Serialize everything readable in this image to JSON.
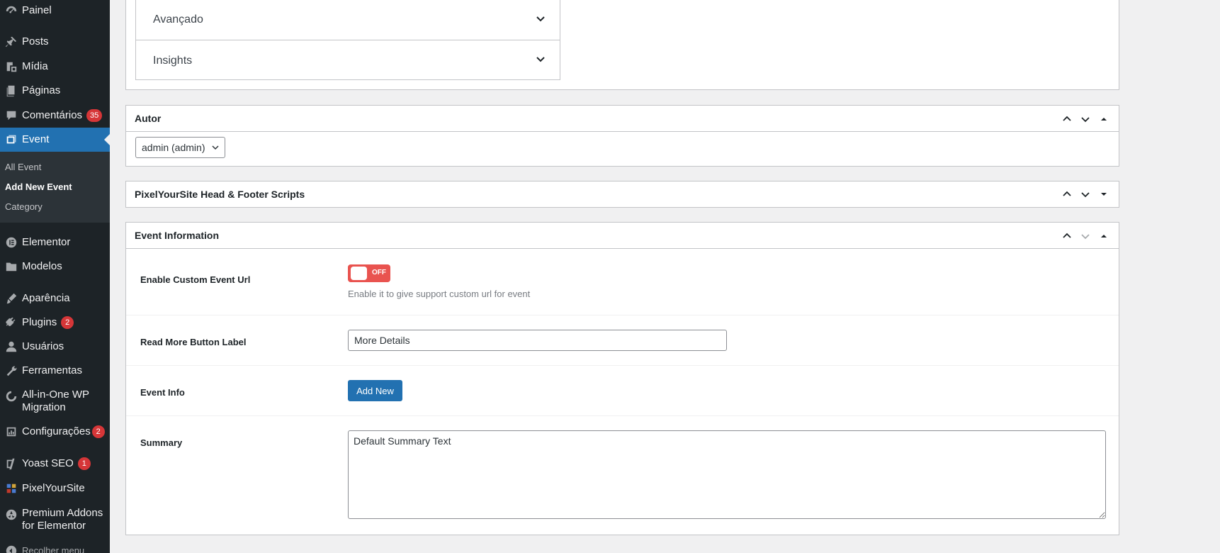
{
  "sidebar": {
    "items": [
      {
        "label": "Painel",
        "icon": "dashboard-icon",
        "badge": ""
      },
      {
        "label": "Posts",
        "icon": "pin-icon",
        "badge": ""
      },
      {
        "label": "Mídia",
        "icon": "media-icon",
        "badge": ""
      },
      {
        "label": "Páginas",
        "icon": "page-icon",
        "badge": ""
      },
      {
        "label": "Comentários",
        "icon": "comment-icon",
        "badge": "35"
      },
      {
        "label": "Event",
        "icon": "event-icon",
        "badge": ""
      },
      {
        "label": "Elementor",
        "icon": "elementor-icon",
        "badge": ""
      },
      {
        "label": "Modelos",
        "icon": "folder-icon",
        "badge": ""
      },
      {
        "label": "Aparência",
        "icon": "brush-icon",
        "badge": ""
      },
      {
        "label": "Plugins",
        "icon": "plug-icon",
        "badge": "2"
      },
      {
        "label": "Usuários",
        "icon": "user-icon",
        "badge": ""
      },
      {
        "label": "Ferramentas",
        "icon": "wrench-icon",
        "badge": ""
      },
      {
        "label": "All-in-One WP",
        "label2": "Migration",
        "icon": "migration-icon",
        "badge": ""
      },
      {
        "label": "Configurações",
        "icon": "settings-icon",
        "badge": "2"
      },
      {
        "label": "Yoast SEO",
        "icon": "yoast-icon",
        "badge": "1"
      },
      {
        "label": "PixelYourSite",
        "icon": "pixel-icon",
        "badge": ""
      },
      {
        "label": "Premium Addons",
        "label2": "for Elementor",
        "icon": "premium-addons-icon",
        "badge": ""
      },
      {
        "label": "Recolher menu",
        "icon": "collapse-icon",
        "badge": ""
      }
    ],
    "submenu": [
      "All Event",
      "Add New Event",
      "Category"
    ]
  },
  "accordion": [
    "Avançado",
    "Insights"
  ],
  "author_box": {
    "title": "Autor",
    "selected": "admin (admin)"
  },
  "pys_box": {
    "title": "PixelYourSite Head & Footer Scripts"
  },
  "event_info": {
    "title": "Event Information",
    "custom_url_label": "Enable Custom Event Url",
    "toggle_text": "OFF",
    "custom_url_hint": "Enable it to give support custom url for event",
    "read_more_label": "Read More Button Label",
    "read_more_value": "More Details",
    "event_info_label": "Event Info",
    "add_new_label": "Add New",
    "summary_label": "Summary",
    "summary_value": "Default Summary Text"
  },
  "colors": {
    "sidebar": "#1d2327",
    "accent": "#2271b1",
    "badge": "#d63638",
    "toggle_off": "#e9534f"
  }
}
